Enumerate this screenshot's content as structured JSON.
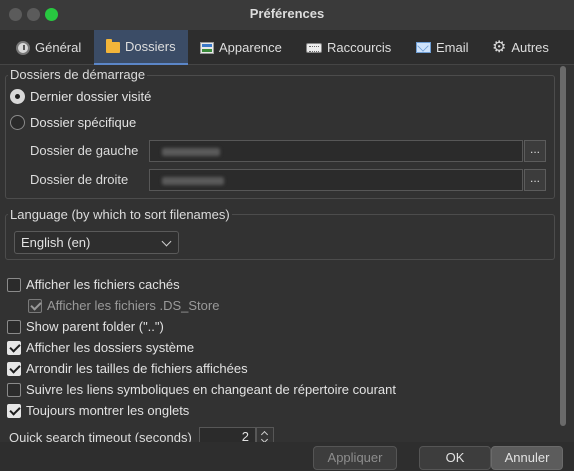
{
  "window": {
    "title": "Préférences"
  },
  "tabs": [
    {
      "label": "Général",
      "icon": "clock-icon"
    },
    {
      "label": "Dossiers",
      "icon": "folder-icon",
      "active": true
    },
    {
      "label": "Apparence",
      "icon": "appearance-icon"
    },
    {
      "label": "Raccourcis",
      "icon": "keyboard-icon"
    },
    {
      "label": "Email",
      "icon": "mail-icon"
    },
    {
      "label": "Autres",
      "icon": "gear-icon"
    }
  ],
  "startup": {
    "group_title": "Dossiers de démarrage",
    "option_last": "Dernier dossier visité",
    "option_specific": "Dossier spécifique",
    "selected": "Dernier dossier visité",
    "left_label": "Dossier de gauche",
    "right_label": "Dossier de droite",
    "browse_label": "..."
  },
  "language": {
    "group_title": "Language (by which to sort filenames)",
    "selected": "English (en)"
  },
  "options": [
    {
      "label": "Afficher les fichiers cachés",
      "checked": false
    },
    {
      "label": "Afficher les fichiers .DS_Store",
      "checked": true,
      "disabled": true
    },
    {
      "label": "Show parent folder (\"..\")",
      "checked": false
    },
    {
      "label": "Afficher les dossiers système",
      "checked": true
    },
    {
      "label": "Arrondir les tailles de fichiers affichées",
      "checked": true
    },
    {
      "label": "Suivre les liens symboliques en changeant de répertoire courant",
      "checked": false
    },
    {
      "label": "Toujours montrer les onglets",
      "checked": true
    }
  ],
  "quick_search": {
    "label": "Quick search timeout (seconds)",
    "value": "2"
  },
  "buttons": {
    "apply": "Appliquer",
    "ok": "OK",
    "cancel": "Annuler"
  },
  "colors": {
    "background": "#323232",
    "active_tab": "#3b4c66",
    "accent": "#5b86c8"
  }
}
